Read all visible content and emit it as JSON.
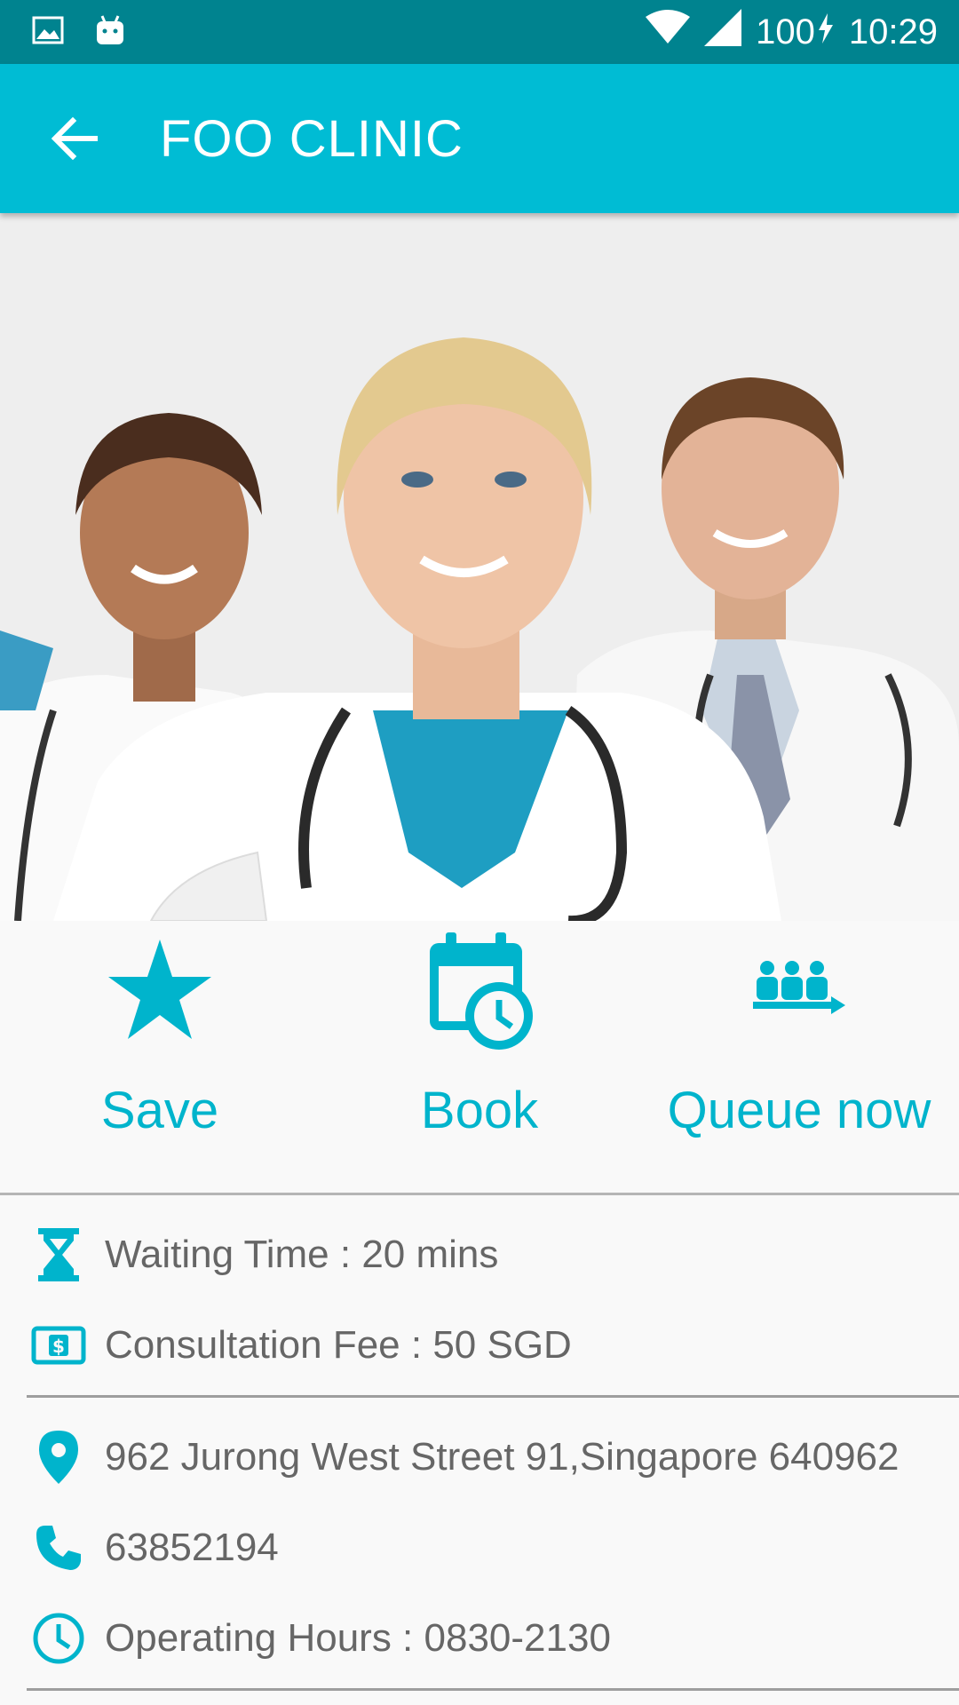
{
  "status_bar": {
    "battery": "100",
    "time": "10:29",
    "icons": [
      "image-icon",
      "android-icon",
      "wifi-icon",
      "signal-icon",
      "charging-icon"
    ]
  },
  "app_bar": {
    "title": "FOO CLINIC",
    "back_icon": "arrow-back-icon"
  },
  "hero": {
    "image_subject": "doctors-photo"
  },
  "actions": [
    {
      "label": "Save",
      "icon": "star-icon"
    },
    {
      "label": "Book",
      "icon": "calendar-clock-icon"
    },
    {
      "label": "Queue now",
      "icon": "queue-icon"
    }
  ],
  "info": {
    "waiting_time": "Waiting Time : 20 mins",
    "consultation_fee": "Consultation Fee : 50 SGD",
    "address": "962 Jurong West Street 91,Singapore 640962",
    "phone": "63852194",
    "operating_hours": "Operating Hours : 0830-2130"
  },
  "colors": {
    "status_bar": "#00838f",
    "app_bar": "#00bcd4",
    "accent": "#00b4cc",
    "text_secondary": "#666666"
  }
}
